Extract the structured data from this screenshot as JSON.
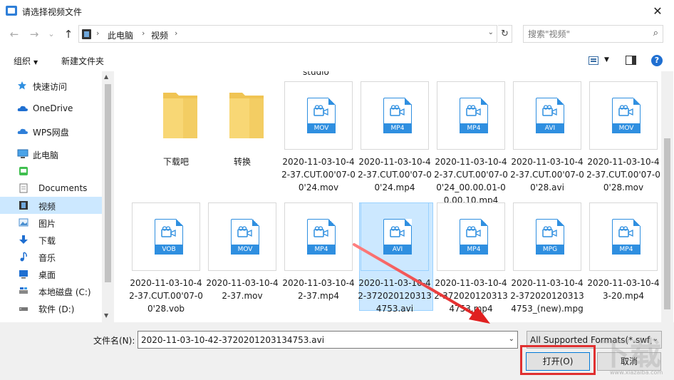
{
  "window": {
    "title": "请选择视频文件",
    "close_glyph": "✕"
  },
  "nav": {
    "back": "←",
    "forward": "→",
    "recent": "⌄",
    "up": "↑"
  },
  "address": {
    "crumbs": [
      "此电脑",
      "视频"
    ],
    "separator": "›"
  },
  "search": {
    "placeholder": "搜索\"视频\""
  },
  "toolbar": {
    "organize": "组织",
    "new_folder": "新建文件夹"
  },
  "sidebar": {
    "items": [
      {
        "label": "快速访问",
        "icon": "star-icon"
      },
      {
        "label": "OneDrive",
        "icon": "cloud-icon"
      },
      {
        "label": "WPS网盘",
        "icon": "cloud-icon"
      },
      {
        "label": "此电脑",
        "icon": "computer-icon"
      },
      {
        "label": "",
        "icon": "app-icon"
      },
      {
        "label": "Documents",
        "icon": "document-icon"
      },
      {
        "label": "视频",
        "icon": "video-folder-icon",
        "selected": true
      },
      {
        "label": "图片",
        "icon": "pictures-icon"
      },
      {
        "label": "下载",
        "icon": "download-icon"
      },
      {
        "label": "音乐",
        "icon": "music-icon"
      },
      {
        "label": "桌面",
        "icon": "desktop-icon"
      },
      {
        "label": "本地磁盘 (C:)",
        "icon": "drive-icon"
      },
      {
        "label": "软件 (D:)",
        "icon": "drive-icon"
      }
    ]
  },
  "files": {
    "partial_label": "studio",
    "items": [
      {
        "name": "下载吧",
        "type": "folder"
      },
      {
        "name": "转换",
        "type": "folder"
      },
      {
        "name": "2020-11-03-10-42-37.CUT.00'07-00'24.mov",
        "badge": "MOV"
      },
      {
        "name": "2020-11-03-10-42-37.CUT.00'07-00'24.mp4",
        "badge": "MP4"
      },
      {
        "name": "2020-11-03-10-42-37.CUT.00'07-00'24_00.00.01-00.00.10.mp4",
        "badge": "MP4"
      },
      {
        "name": "2020-11-03-10-42-37.CUT.00'07-00'28.avi",
        "badge": "AVI"
      },
      {
        "name": "2020-11-03-10-42-37.CUT.00'07-00'28.mov",
        "badge": "MOV"
      },
      {
        "name": "2020-11-03-10-42-37.CUT.00'07-00'28.vob",
        "badge": "VOB"
      },
      {
        "name": "2020-11-03-10-42-37.mov",
        "badge": "MOV"
      },
      {
        "name": "2020-11-03-10-42-37.mp4",
        "badge": "MP4"
      },
      {
        "name": "2020-11-03-10-42-3720201203134753.avi",
        "badge": "AVI",
        "selected": true
      },
      {
        "name": "2020-11-03-10-42-3720201203134753.mp4",
        "badge": "MP4"
      },
      {
        "name": "2020-11-03-10-42-3720201203134753_(new).mpg",
        "badge": "MPG"
      },
      {
        "name": "2020-11-03-10-43-20.mp4",
        "badge": "MP4"
      }
    ]
  },
  "bottom": {
    "filename_label": "文件名(N):",
    "filename_value": "2020-11-03-10-42-3720201203134753.avi",
    "filter_value": "All Supported Formats(*.swf;",
    "open_label": "打开(O)",
    "cancel_label": "取消"
  },
  "colors": {
    "accent": "#2f8fe0",
    "selection": "#cce8ff",
    "annotation": "#e03030"
  }
}
